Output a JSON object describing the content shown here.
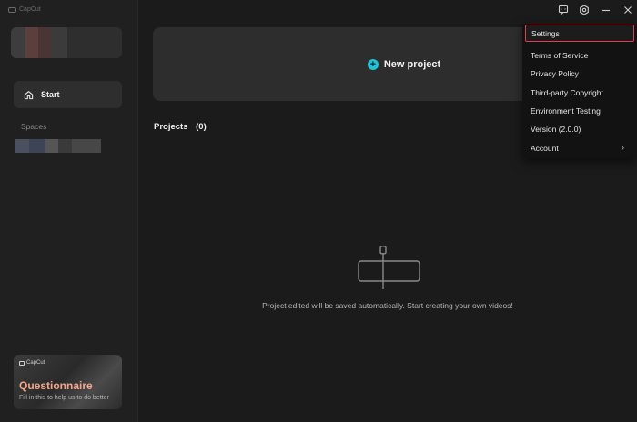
{
  "app": {
    "title": "CapCut"
  },
  "sidebar": {
    "nav": [
      {
        "label": "Start",
        "icon": "home-icon",
        "active": true
      }
    ],
    "spaces_title": "Spaces"
  },
  "questionnaire": {
    "brand": "CapCut",
    "title": "Questionnaire",
    "subtitle": "Fill in this to help us to do better"
  },
  "main": {
    "new_project_label": "New project",
    "projects_title": "Projects",
    "projects_count": "(0)",
    "empty_text": "Project edited will be saved automatically. Start creating your own videos!"
  },
  "window_controls": {
    "icons": [
      "feedback-icon",
      "settings-gear-icon",
      "minimize-icon",
      "close-icon"
    ]
  },
  "menu": {
    "items": [
      {
        "label": "Settings",
        "selected": true
      },
      {
        "label": "Terms of Service"
      },
      {
        "label": "Privacy Policy"
      },
      {
        "label": "Third-party Copyright"
      },
      {
        "label": "Environment Testing"
      },
      {
        "label": "Version (2.0.0)"
      },
      {
        "label": "Account",
        "submenu": true
      }
    ]
  },
  "colors": {
    "accent": "#1fc4d8",
    "selection_border": "#e23d4f",
    "questionnaire_title": "#f3a68a"
  }
}
